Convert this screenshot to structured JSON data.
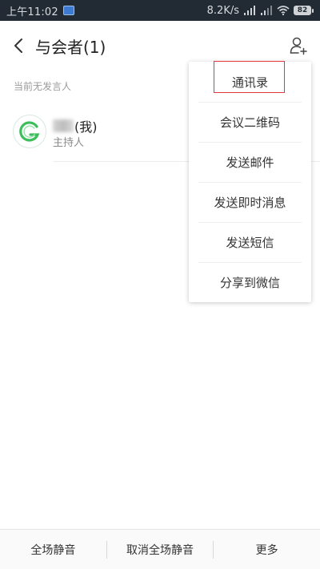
{
  "status_bar": {
    "time": "上午11:02",
    "net_speed": "8.2K/s",
    "battery": "82"
  },
  "header": {
    "title": "与会者(1)"
  },
  "section_label": "当前无发言人",
  "participant": {
    "name_suffix": "(我)",
    "role": "主持人"
  },
  "menu": {
    "items": [
      {
        "label": "通讯录"
      },
      {
        "label": "会议二维码"
      },
      {
        "label": "发送邮件"
      },
      {
        "label": "发送即时消息"
      },
      {
        "label": "发送短信"
      },
      {
        "label": "分享到微信"
      }
    ]
  },
  "bottom_bar": {
    "mute_all": "全场静音",
    "unmute_all": "取消全场静音",
    "more": "更多"
  },
  "colors": {
    "status_bar_bg": "#222b33",
    "highlight": "#e53935",
    "avatar_green": "#3cbf5a"
  }
}
